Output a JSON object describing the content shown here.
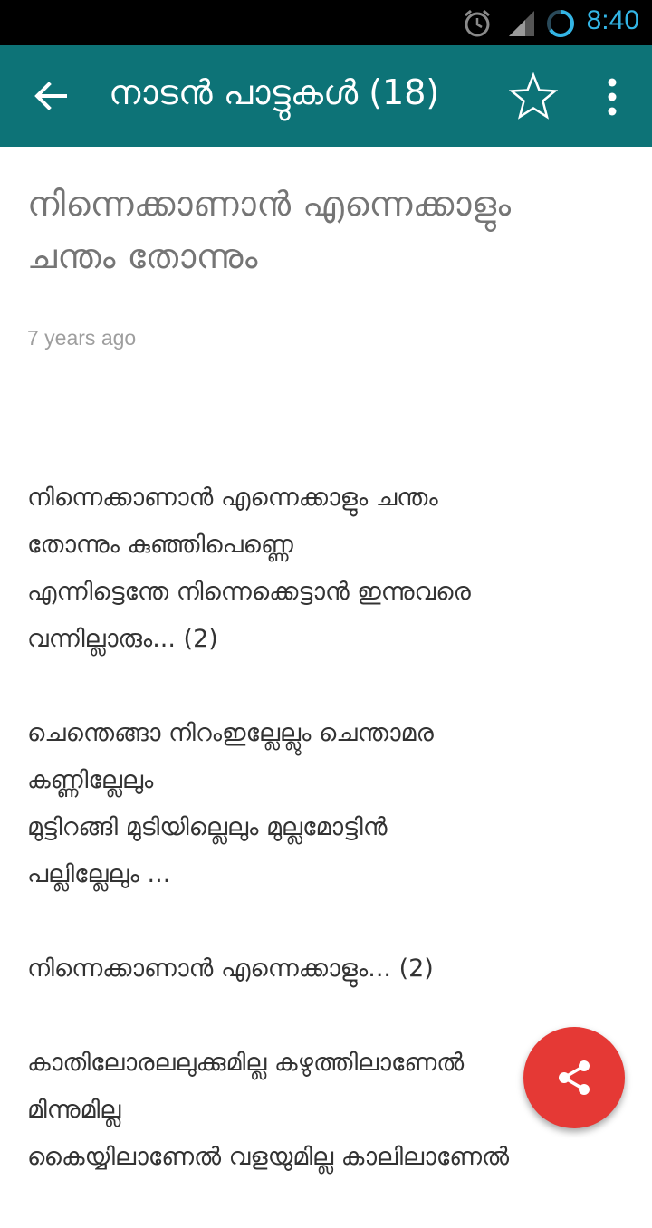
{
  "status_bar": {
    "time": "8:40"
  },
  "app_bar": {
    "title": "നാടൻ പാട്ടുകൾ (18)"
  },
  "article": {
    "title_lines": [
      "നിന്നെക്കാണാൻ എന്നെക്കാളും",
      "ചന്തം തോന്നും"
    ],
    "time_ago": "7 years ago",
    "lines": [
      "നിന്നെക്കാണാൻ എന്നെക്കാളും ചന്തം",
      "തോന്നും കുഞ്ഞിപെണ്ണെ",
      "എന്നിട്ടെന്തേ നിന്നെക്കെട്ടാൻ ഇന്നുവരെ",
      "വന്നില്ലാരും... (2)",
      "ചെന്തെങ്ങാ നിറംഇല്ലേല്ലും ചെന്താമര",
      "കണ്ണില്ലേലും",
      "മുട്ടിറങ്ങി മുടിയില്ലെലും മുല്ലമോട്ടിൻ",
      "പല്ലില്ലേലും ...",
      "നിന്നെക്കാണാൻ എന്നെക്കാളും... (2)",
      "കാതിലോരലലുക്കുമില്ല കഴുത്തിലാണേൽ",
      "മിന്നുമില്ല",
      "കൈയ്യിലാണേൽ വളയുമില്ല കാലിലാണേൽ"
    ]
  }
}
